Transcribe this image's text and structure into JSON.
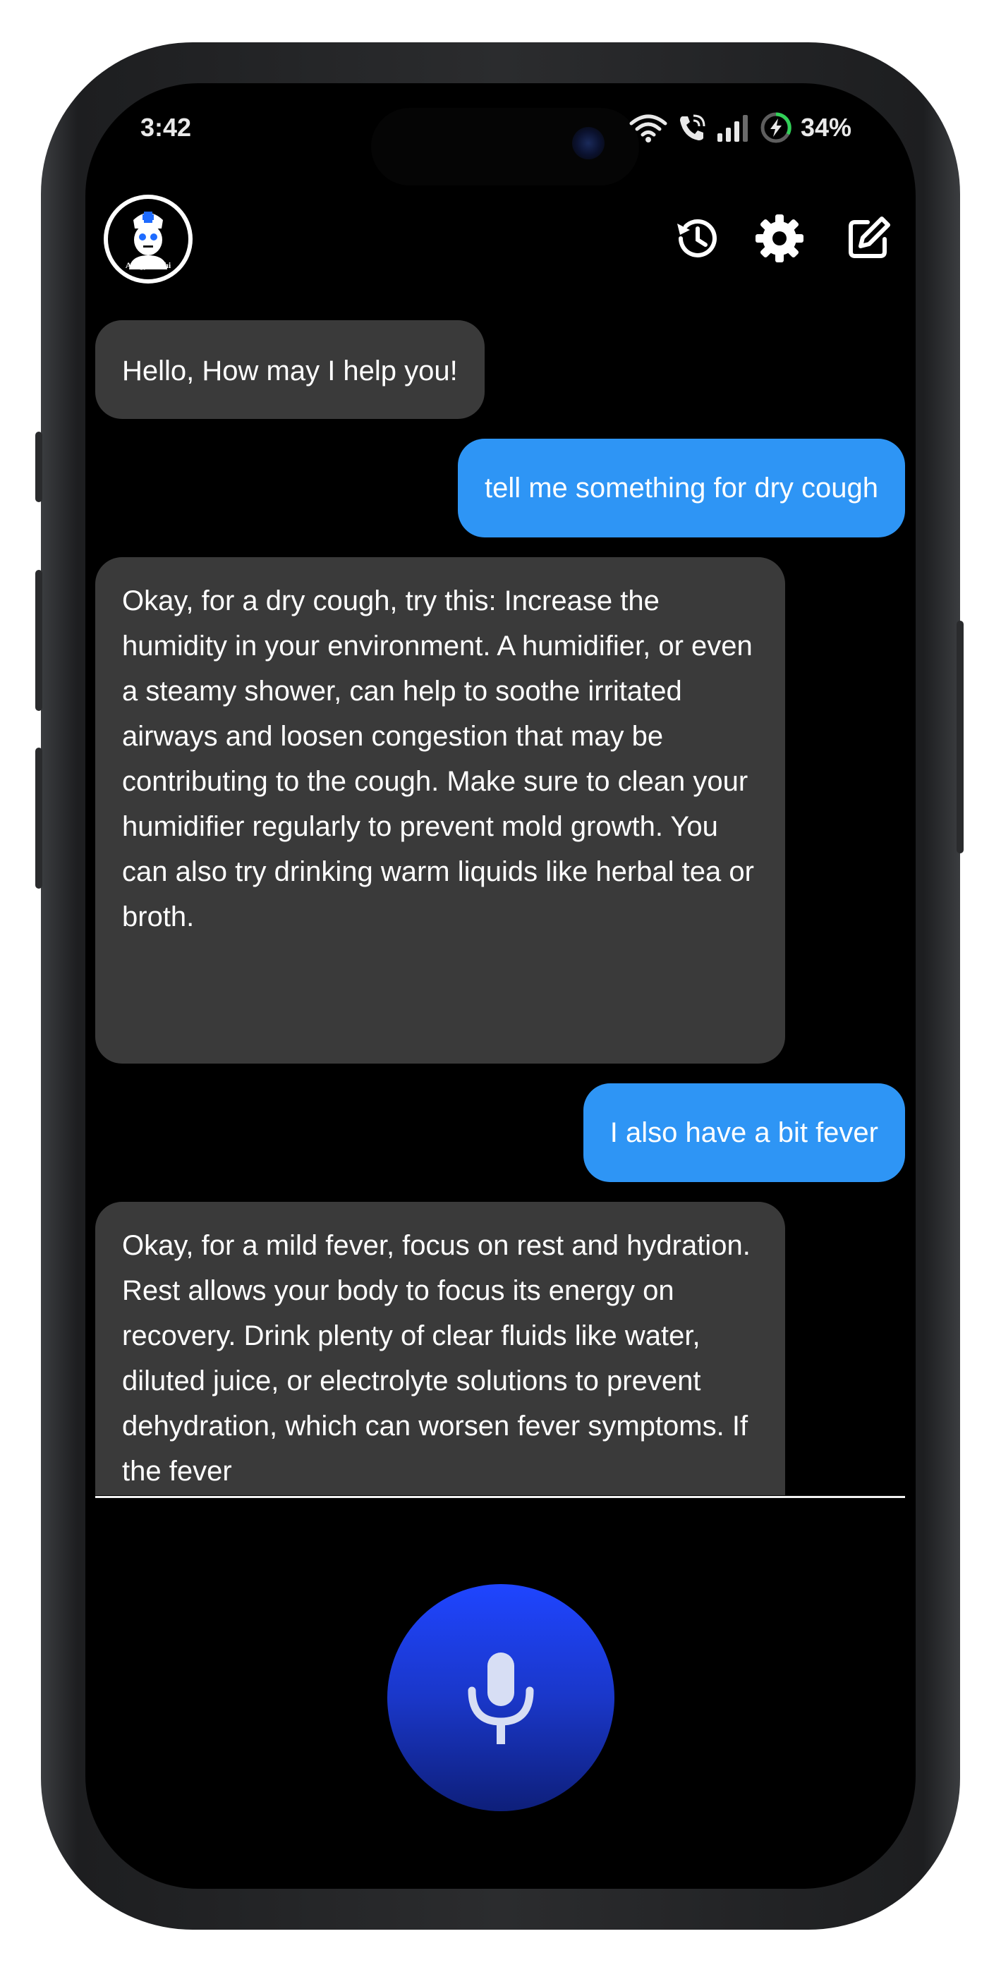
{
  "status_bar": {
    "time": "3:42",
    "battery": "34%",
    "icons": [
      "wifi-icon",
      "wifi-calling-icon",
      "signal-icon",
      "battery-charging-icon"
    ]
  },
  "header": {
    "app_logo_text": "ArogyaSathi",
    "actions": [
      "history-icon",
      "gear-icon",
      "edit-icon"
    ]
  },
  "messages": [
    {
      "role": "bot",
      "text": "Hello, How may I help you!"
    },
    {
      "role": "user",
      "text": "tell me something for dry cough"
    },
    {
      "role": "bot",
      "text": "Okay, for a dry cough, try this: Increase the humidity in your environment. A humidifier, or even a steamy shower, can help to soothe irritated airways and loosen congestion that may be contributing to the cough. Make sure to clean your humidifier regularly to prevent mold growth. You can also try drinking warm liquids like herbal tea or broth."
    },
    {
      "role": "user",
      "text": "I also have a bit fever"
    },
    {
      "role": "bot",
      "text": "Okay, for a mild fever, focus on rest and hydration. Rest allows your body to focus its energy on recovery. Drink plenty of clear fluids like water, diluted juice, or electrolyte solutions to prevent dehydration, which can worsen fever symptoms. If the fever"
    }
  ],
  "colors": {
    "background": "#000000",
    "bot_bubble": "#3a3a3a",
    "user_bubble": "#2e95f5",
    "mic_button": "#1f45ff"
  },
  "mic": {
    "icon": "microphone-icon"
  }
}
